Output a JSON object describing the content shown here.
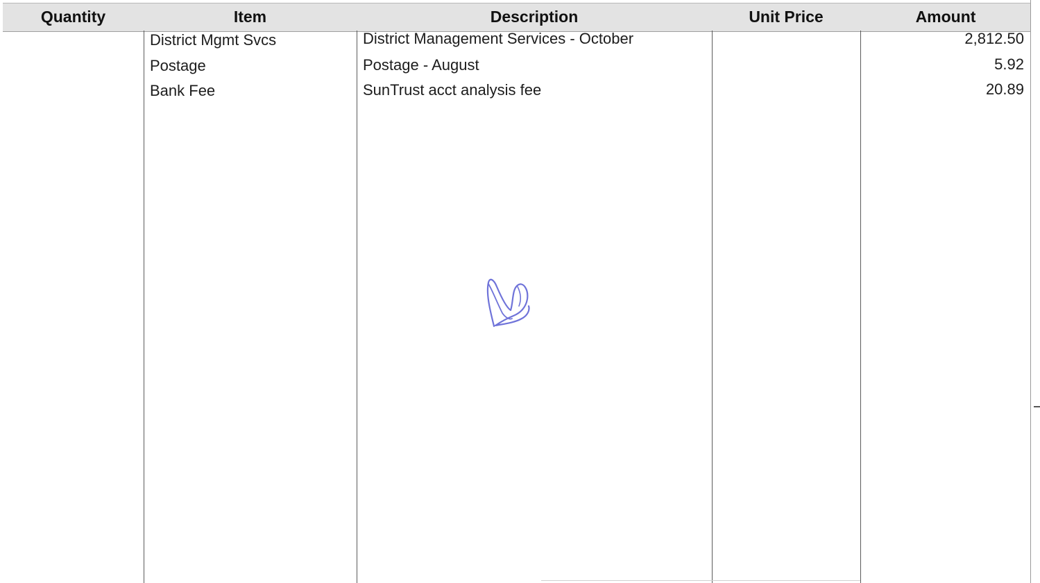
{
  "columns": {
    "quantity": "Quantity",
    "item": "Item",
    "description": "Description",
    "unit_price": "Unit Price",
    "amount": "Amount"
  },
  "rows": [
    {
      "quantity": "",
      "item": "District Mgmt Svcs",
      "description": "District Management Services - October",
      "unit_price": "",
      "amount": "2,812.50"
    },
    {
      "quantity": "",
      "item": "Postage",
      "description": "Postage - August",
      "unit_price": "",
      "amount": "5.92"
    },
    {
      "quantity": "",
      "item": "Bank Fee",
      "description": "SunTrust acct analysis fee",
      "unit_price": "",
      "amount": "20.89"
    }
  ],
  "colors": {
    "header_bg": "#e3e3e3",
    "grid_line": "#5a5a5a",
    "ink_signature": "#6f73d9"
  }
}
